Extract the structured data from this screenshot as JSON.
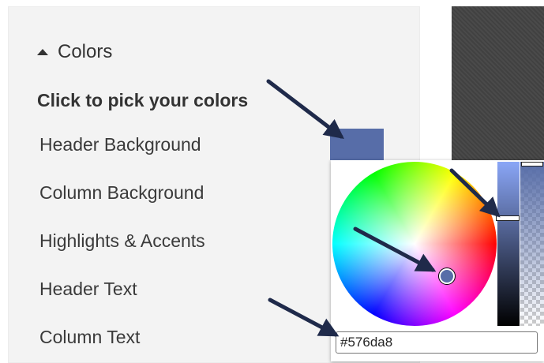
{
  "section": {
    "title": "Colors",
    "toggle_icon": "caret-up-icon"
  },
  "heading": "Click to pick your colors",
  "color_items": [
    {
      "label": "Header Background"
    },
    {
      "label": "Column Background"
    },
    {
      "label": "Highlights & Accents"
    },
    {
      "label": "Header Text"
    },
    {
      "label": "Column Text"
    }
  ],
  "picker": {
    "hex_value": "#576da8",
    "selected_color": "#576da8",
    "brightness_fraction": 0.34,
    "alpha": 1.0
  },
  "colors": {
    "panel_bg": "#f3f3f3",
    "preview_bg": "#444444",
    "arrow": "#1f2a4a"
  }
}
